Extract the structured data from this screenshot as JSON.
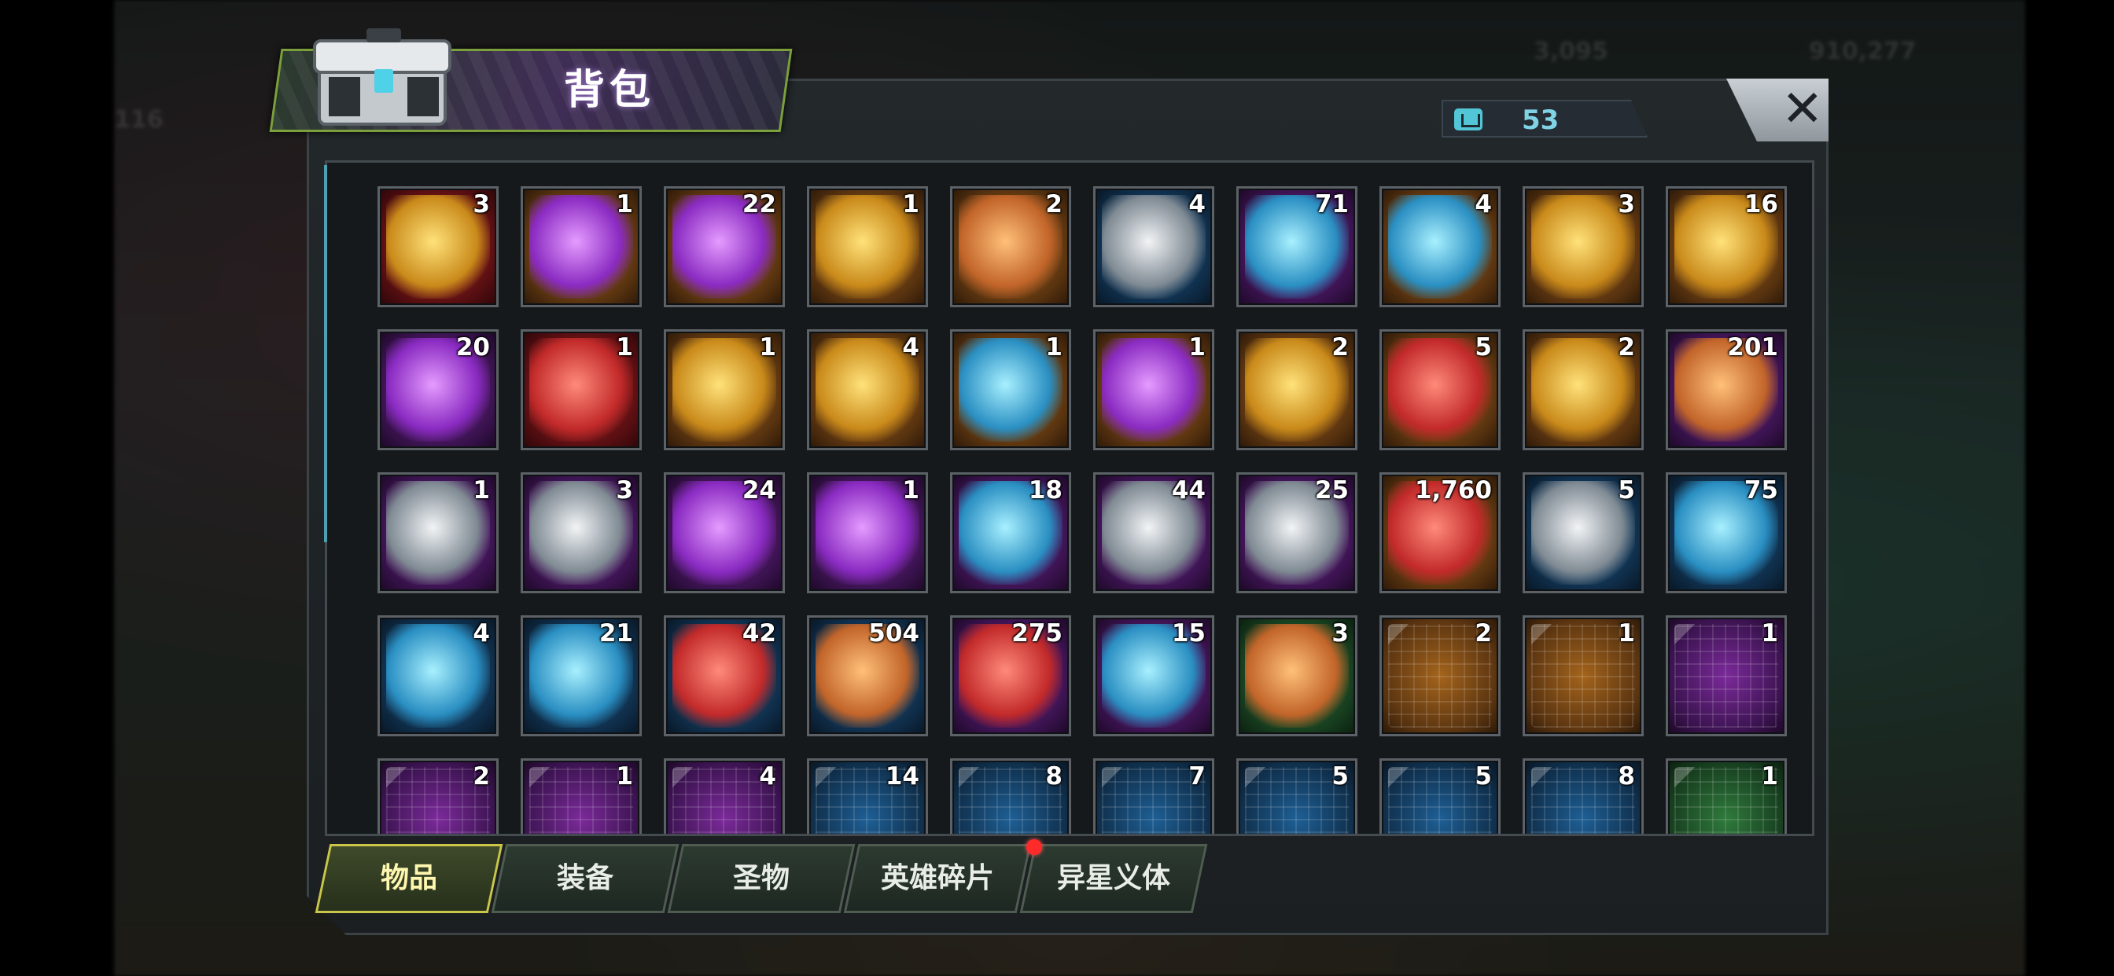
{
  "window": {
    "title": "背包",
    "capacity": "53",
    "close_label": "✕"
  },
  "background_hud": {
    "left_counter": "116",
    "resource_a": "3,095",
    "resource_b": "910,277"
  },
  "items": [
    {
      "count": "3",
      "rarity": "red",
      "icon": "sss-chest-ii-icon",
      "art": "gold"
    },
    {
      "count": "1",
      "rarity": "orange",
      "icon": "crystal-chest-lv3-icon",
      "art": "violet"
    },
    {
      "count": "22",
      "rarity": "orange",
      "icon": "crystal-chest-lv1-icon",
      "art": "violet"
    },
    {
      "count": "1",
      "rarity": "orange",
      "icon": "gold-chest-icon",
      "art": "gold"
    },
    {
      "count": "2",
      "rarity": "orange",
      "icon": "supply-chest-icon",
      "art": "orangeart"
    },
    {
      "count": "4",
      "rarity": "blue",
      "icon": "tech-crate-iv-icon",
      "art": "silver"
    },
    {
      "count": "71",
      "rarity": "purple",
      "icon": "ring-device-icon",
      "art": "cyan"
    },
    {
      "count": "4",
      "rarity": "orange",
      "icon": "blue-case-icon",
      "art": "cyan"
    },
    {
      "count": "3",
      "rarity": "orange",
      "icon": "speedup-24h-icon",
      "art": "gold"
    },
    {
      "count": "16",
      "rarity": "orange",
      "icon": "gold-speedup-24h-icon",
      "art": "gold"
    },
    {
      "count": "20",
      "rarity": "purple",
      "icon": "speedup-12h-icon",
      "art": "violet"
    },
    {
      "count": "1",
      "rarity": "red",
      "icon": "red-shard-icon",
      "art": "redart"
    },
    {
      "count": "1",
      "rarity": "orange",
      "icon": "gold-pumpkin-icon",
      "art": "gold"
    },
    {
      "count": "4",
      "rarity": "orange",
      "icon": "gold-shard-icon",
      "art": "gold"
    },
    {
      "count": "1",
      "rarity": "orange",
      "icon": "crystal-prism-icon",
      "art": "cyan"
    },
    {
      "count": "1",
      "rarity": "orange",
      "icon": "purple-gem-icon",
      "art": "violet"
    },
    {
      "count": "2",
      "rarity": "orange",
      "icon": "emblem-coin-icon",
      "art": "gold"
    },
    {
      "count": "5",
      "rarity": "orange",
      "icon": "neon-cap-icon",
      "art": "redart"
    },
    {
      "count": "2",
      "rarity": "orange",
      "icon": "dragon-coin-icon",
      "art": "gold"
    },
    {
      "count": "201",
      "rarity": "purple",
      "icon": "pumpkin-icon",
      "art": "orangeart"
    },
    {
      "count": "1",
      "rarity": "purple",
      "icon": "cube-device-icon",
      "art": "silver"
    },
    {
      "count": "3",
      "rarity": "purple",
      "icon": "film-reel-icon",
      "art": "silver"
    },
    {
      "count": "24",
      "rarity": "purple",
      "icon": "pink-cap-icon",
      "art": "violet"
    },
    {
      "count": "1",
      "rarity": "purple",
      "icon": "poker-chip-icon",
      "art": "violet"
    },
    {
      "count": "18",
      "rarity": "purple",
      "icon": "police-badge-icon",
      "art": "cyan"
    },
    {
      "count": "44",
      "rarity": "purple",
      "icon": "fish-statue-icon",
      "art": "silver"
    },
    {
      "count": "25",
      "rarity": "purple",
      "icon": "s02-medal-icon",
      "art": "silver"
    },
    {
      "count": "1,760",
      "rarity": "orange",
      "icon": "ticket-stack-icon",
      "art": "redart"
    },
    {
      "count": "5",
      "rarity": "blue",
      "icon": "gold-face-coin-icon",
      "art": "silver"
    },
    {
      "count": "75",
      "rarity": "blue",
      "icon": "cinema-ticket-icon",
      "art": "cyan"
    },
    {
      "count": "4",
      "rarity": "blue",
      "icon": "timer-coin-icon",
      "art": "cyan"
    },
    {
      "count": "21",
      "rarity": "blue",
      "icon": "blue-cap-icon",
      "art": "cyan"
    },
    {
      "count": "42",
      "rarity": "blue",
      "icon": "red-chip-icon",
      "art": "redart"
    },
    {
      "count": "504",
      "rarity": "blue",
      "icon": "bullet-icon",
      "art": "orangeart"
    },
    {
      "count": "275",
      "rarity": "purple",
      "icon": "xmas-ornament-icon",
      "art": "redart"
    },
    {
      "count": "15",
      "rarity": "purple",
      "icon": "ice-crystal-icon",
      "art": "cyan"
    },
    {
      "count": "3",
      "rarity": "green",
      "icon": "frog-ring-icon",
      "art": "orangeart"
    },
    {
      "count": "2",
      "rarity": "orange",
      "icon": "shirt-blueprint-icon",
      "art": "blueprint"
    },
    {
      "count": "1",
      "rarity": "orange",
      "icon": "boot-blueprint-icon",
      "art": "blueprint"
    },
    {
      "count": "1",
      "rarity": "purple",
      "icon": "sword-blueprint-icon",
      "art": "blueprint"
    },
    {
      "count": "2",
      "rarity": "purple",
      "icon": "blueprint-icon",
      "art": "blueprint"
    },
    {
      "count": "1",
      "rarity": "purple",
      "icon": "blueprint-icon",
      "art": "blueprint"
    },
    {
      "count": "4",
      "rarity": "purple",
      "icon": "blueprint-icon",
      "art": "blueprint"
    },
    {
      "count": "14",
      "rarity": "blue",
      "icon": "blueprint-icon",
      "art": "blueprint"
    },
    {
      "count": "8",
      "rarity": "blue",
      "icon": "blueprint-icon",
      "art": "blueprint"
    },
    {
      "count": "7",
      "rarity": "blue",
      "icon": "blueprint-icon",
      "art": "blueprint"
    },
    {
      "count": "5",
      "rarity": "blue",
      "icon": "blueprint-icon",
      "art": "blueprint"
    },
    {
      "count": "5",
      "rarity": "blue",
      "icon": "blueprint-icon",
      "art": "blueprint"
    },
    {
      "count": "8",
      "rarity": "blue",
      "icon": "blueprint-icon",
      "art": "blueprint"
    },
    {
      "count": "1",
      "rarity": "green",
      "icon": "blueprint-icon",
      "art": "blueprint"
    }
  ],
  "tabs": [
    {
      "label": "物品",
      "active": true
    },
    {
      "label": "装备",
      "active": false
    },
    {
      "label": "圣物",
      "active": false
    },
    {
      "label": "英雄碎片",
      "active": false,
      "notification": true
    },
    {
      "label": "异星义体",
      "active": false
    }
  ]
}
